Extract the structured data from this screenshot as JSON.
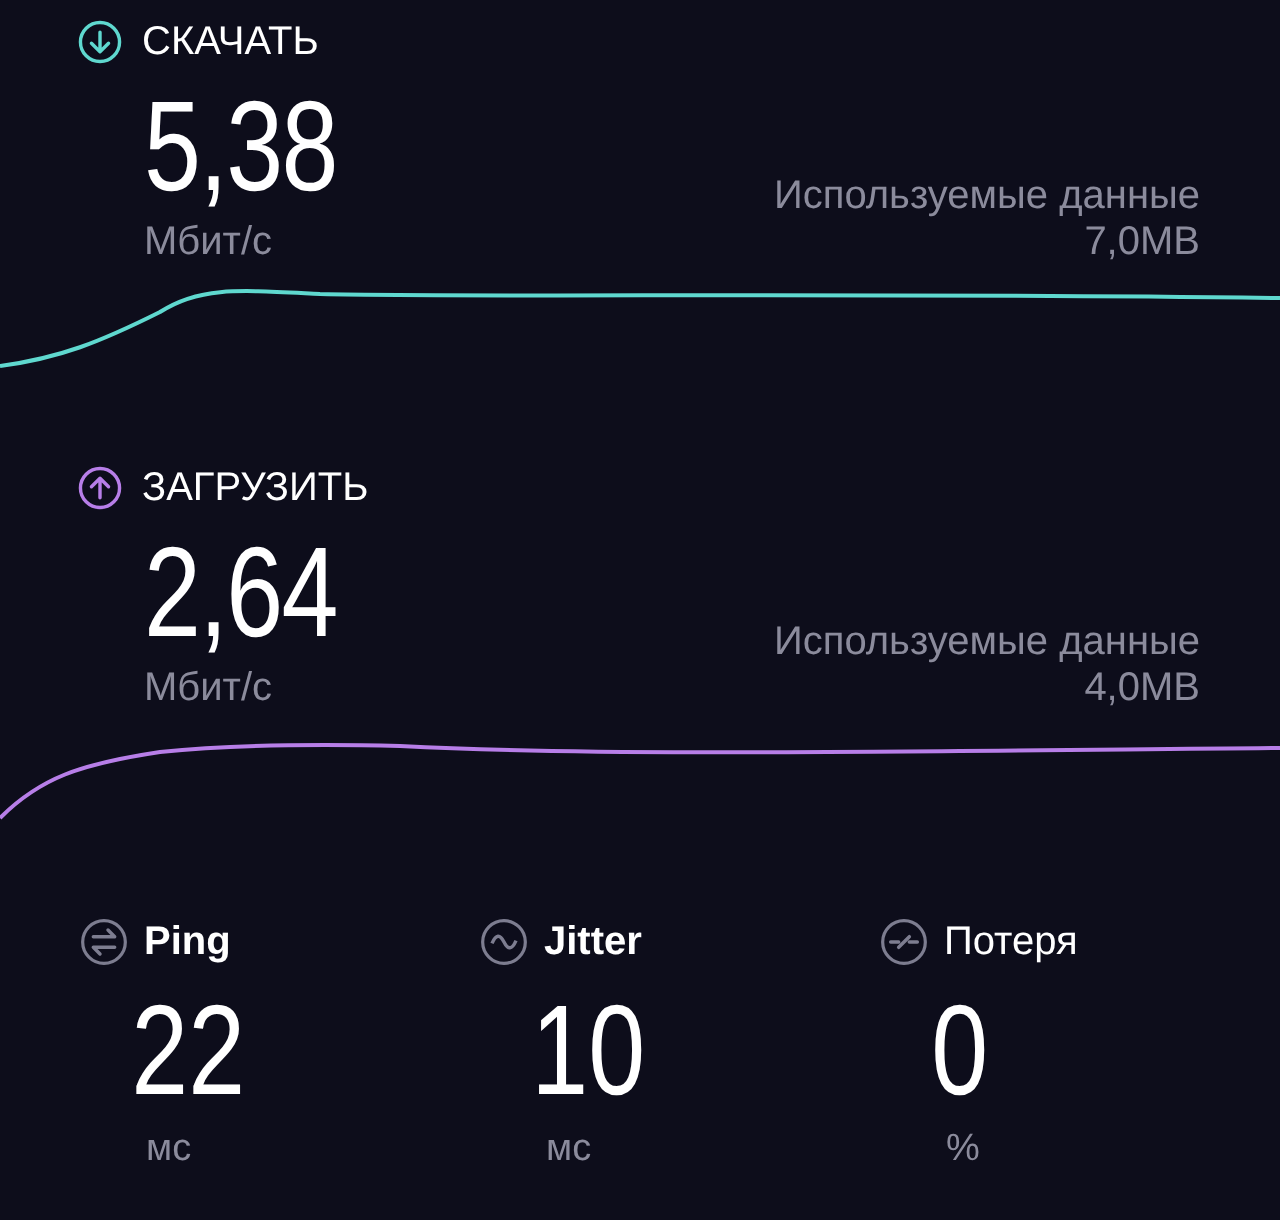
{
  "tests": [
    {
      "label": "СКАЧАТЬ",
      "kind": "download",
      "color": "#5fd8cf",
      "value": "5,38",
      "unit": "Мбит/с",
      "data_label": "Используемые данные",
      "data_value": "7,0MB"
    },
    {
      "label": "ЗАГРУЗИТЬ",
      "kind": "upload",
      "color": "#b77ee8",
      "value": "2,64",
      "unit": "Мбит/с",
      "data_label": "Используемые данные",
      "data_value": "4,0MB"
    }
  ],
  "metrics": [
    {
      "label": "Ping",
      "kind": "ping",
      "value": "22",
      "unit": "мс"
    },
    {
      "label": "Jitter",
      "kind": "jitter",
      "value": "10",
      "unit": "мс"
    },
    {
      "label": "Потеря",
      "kind": "loss",
      "value": "0",
      "unit": "%"
    }
  ]
}
